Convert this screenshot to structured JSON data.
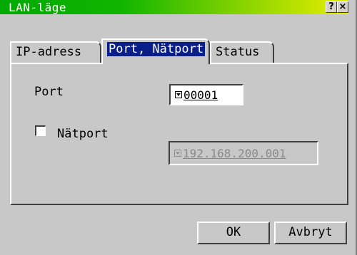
{
  "window": {
    "title": "LAN-läge",
    "help_label": "?",
    "close_label": "×"
  },
  "tabs": [
    {
      "label": "IP-adress",
      "active": false
    },
    {
      "label": "Port, Nätport",
      "active": true
    },
    {
      "label": "Status",
      "active": false
    }
  ],
  "port": {
    "label": "Port",
    "value": "00001"
  },
  "netport": {
    "label": "Nätport",
    "checked": false,
    "value": "192.168.200.001"
  },
  "buttons": {
    "ok": "OK",
    "cancel": "Avbryt"
  },
  "colors": {
    "title_gradient_start": "#00aa00",
    "title_gradient_end": "#e8ee00",
    "tab_highlight": "#0a1e8a",
    "window_bg": "#c8c8c8"
  }
}
